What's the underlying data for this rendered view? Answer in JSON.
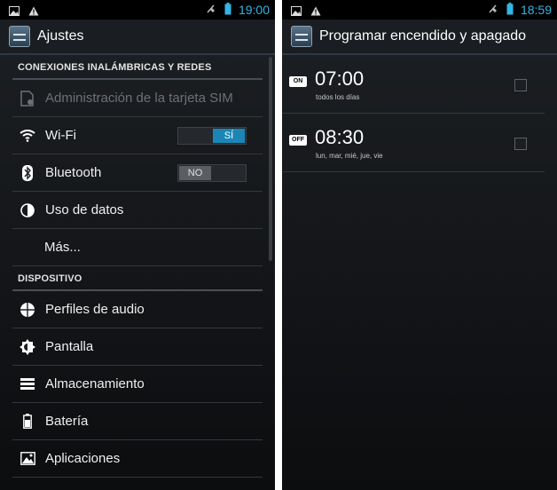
{
  "left": {
    "status": {
      "time": "19:00"
    },
    "title": "Ajustes",
    "sections": {
      "wireless": "CONEXIONES INALÁMBRICAS Y REDES",
      "device": "DISPOSITIVO"
    },
    "items": {
      "sim": "Administración de la tarjeta SIM",
      "wifi": "Wi-Fi",
      "bluetooth": "Bluetooth",
      "data": "Uso de datos",
      "more": "Más...",
      "audio": "Perfiles de audio",
      "display": "Pantalla",
      "storage": "Almacenamiento",
      "battery": "Batería",
      "apps": "Aplicaciones"
    },
    "toggles": {
      "wifi": "SÍ",
      "bluetooth": "NO"
    }
  },
  "right": {
    "status": {
      "time": "18:59"
    },
    "title": "Programar encendido y apagado",
    "alarms": [
      {
        "badge": "ON",
        "time": "07:00",
        "days": "todos los días"
      },
      {
        "badge": "OFF",
        "time": "08:30",
        "days": "lun, mar, mié, jue, vie"
      }
    ]
  },
  "colors": {
    "accent": "#33b5e5",
    "toggle_on": "#1b86b5"
  },
  "icons": [
    "image-icon",
    "warning-icon",
    "signal-muted-icon",
    "battery-icon",
    "sim-icon",
    "wifi-icon",
    "bluetooth-icon",
    "data-usage-icon",
    "audio-profiles-icon",
    "display-icon",
    "storage-icon",
    "apps-icon"
  ]
}
